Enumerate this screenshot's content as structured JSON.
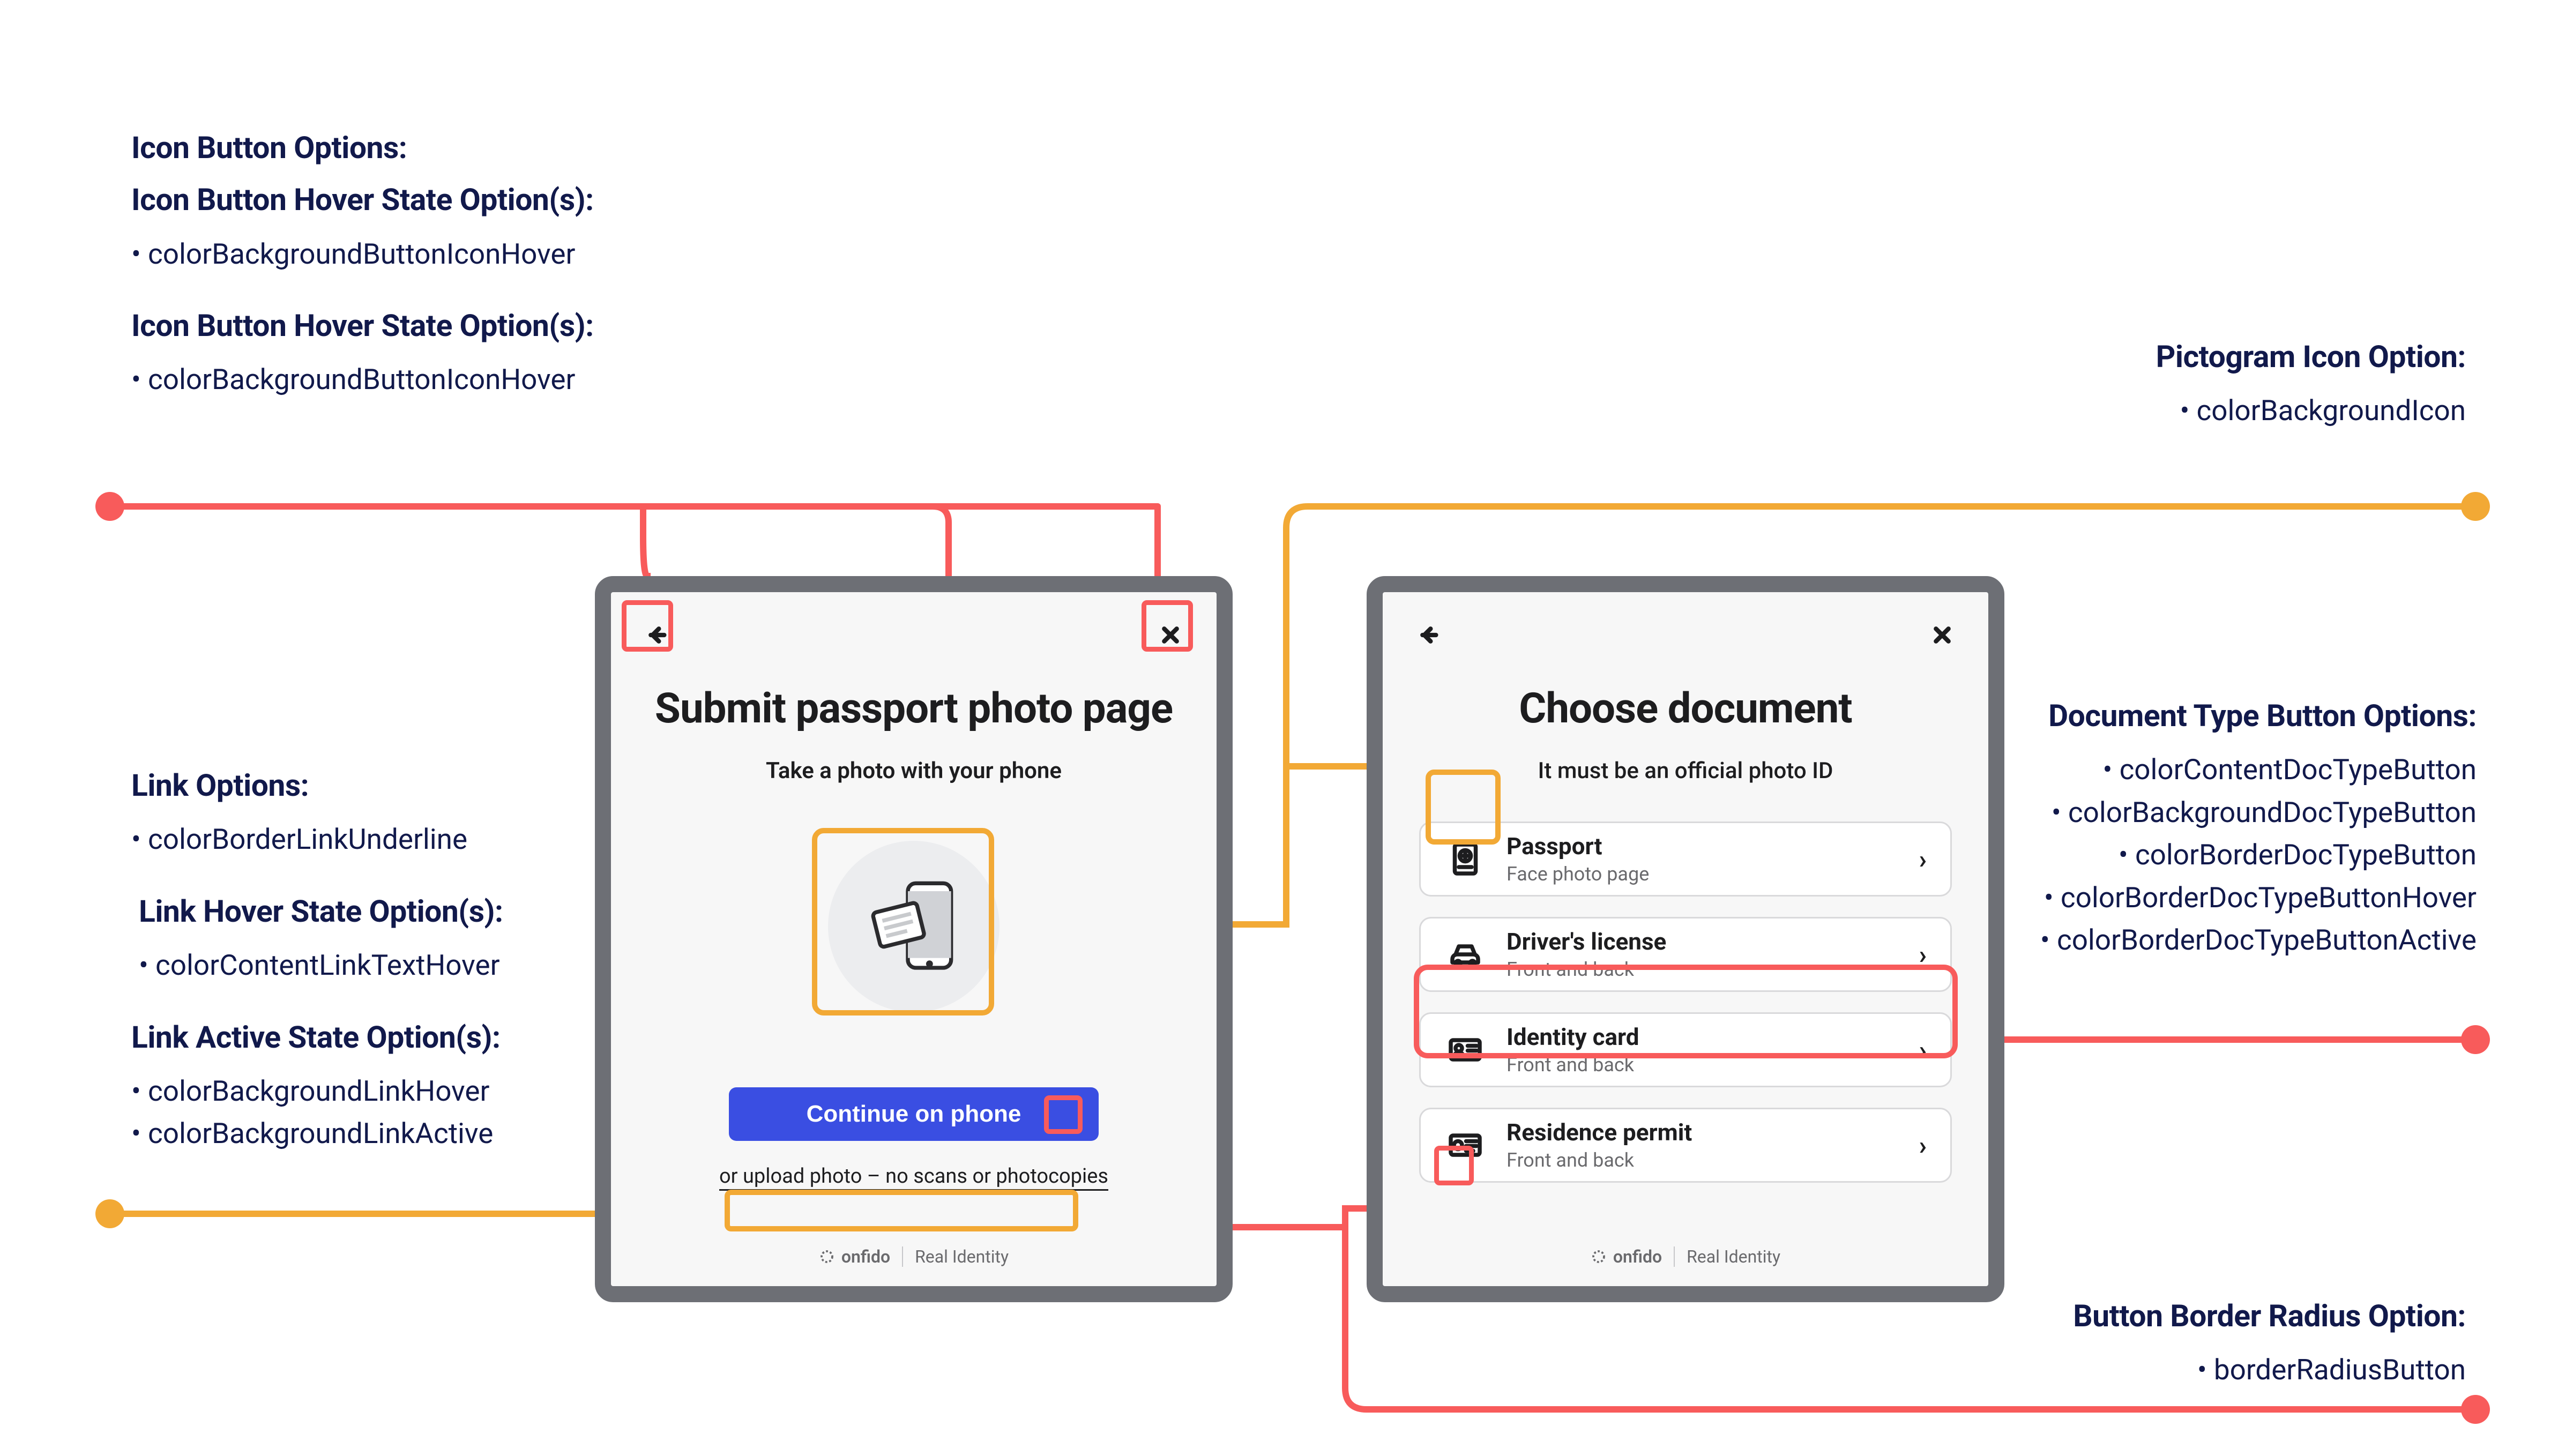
{
  "annotations": {
    "iconButton": {
      "heading": "Icon Button Options:",
      "groups": [
        {
          "heading": "Icon Button Hover State Option(s):",
          "items": [
            "colorBackgroundButtonIconHover"
          ]
        },
        {
          "heading": "Icon Button Hover State Option(s):",
          "items": [
            "colorBackgroundButtonIconHover"
          ]
        }
      ]
    },
    "link": {
      "groups": [
        {
          "heading": "Link Options:",
          "items": [
            "colorBorderLinkUnderline"
          ]
        },
        {
          "heading": "Link Hover State Option(s):",
          "items": [
            "colorContentLinkTextHover"
          ]
        },
        {
          "heading": "Link Active State Option(s):",
          "items": [
            "colorBackgroundLinkHover",
            "colorBackgroundLinkActive"
          ]
        }
      ]
    },
    "pictogram": {
      "heading": "Pictogram Icon Option:",
      "items": [
        "colorBackgroundIcon"
      ]
    },
    "docType": {
      "heading": "Document Type Button Options:",
      "items": [
        "colorContentDocTypeButton",
        "colorBackgroundDocTypeButton",
        "colorBorderDocTypeButton",
        "colorBorderDocTypeButtonHover",
        "colorBorderDocTypeButtonActive"
      ]
    },
    "borderRadius": {
      "heading": "Button Border Radius Option:",
      "items": [
        "borderRadiusButton"
      ]
    }
  },
  "leftScreen": {
    "title": "Submit passport photo page",
    "subtitle": "Take a photo with your phone",
    "primaryButton": "Continue on phone",
    "linkText": "or upload photo – no scans or photocopies",
    "footerBrand": "onfido",
    "footerTag": "Real Identity"
  },
  "rightScreen": {
    "title": "Choose document",
    "subtitle": "It must be an official photo ID",
    "docs": [
      {
        "title": "Passport",
        "sub": "Face photo page"
      },
      {
        "title": "Driver's license",
        "sub": "Front and back"
      },
      {
        "title": "Identity card",
        "sub": "Front and back"
      },
      {
        "title": "Residence permit",
        "sub": "Front and back"
      }
    ],
    "footerBrand": "onfido",
    "footerTag": "Real Identity"
  }
}
